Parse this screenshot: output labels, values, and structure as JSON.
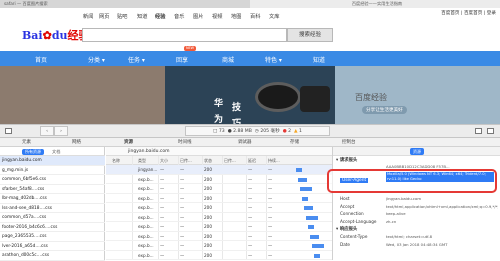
{
  "tabs": [
    "safari — 百度图片搜索",
    "百度经验——实用生活指南"
  ],
  "top_nav": [
    "新闻",
    "网页",
    "贴吧",
    "知道",
    "经验",
    "音乐",
    "图片",
    "视频",
    "地图",
    "百科",
    "文库"
  ],
  "top_links": "百度首页 | 百度首页 | 登录",
  "logo": {
    "bai": "Bai",
    "du": "du",
    "jingyan": "经验"
  },
  "search": {
    "value": "",
    "button": "搜索经验"
  },
  "main_nav": [
    "首页",
    "分类 ▾",
    "任务 ▾",
    "回享",
    "商城",
    "特色 ▾",
    "知道"
  ],
  "new_badge": "NEW",
  "banner": {
    "t1": "华",
    "t2": "技",
    "t3": "为",
    "t4": "巧",
    "brand": "百度经验",
    "slogan": "分享让生活更美好"
  },
  "toolbar": {
    "count": "73",
    "size": "2.88 MB",
    "time": "205 毫秒",
    "errors": "2",
    "warnings": "1"
  },
  "devtabs": [
    "元素",
    "网络",
    "资源",
    "时间线",
    "调试器",
    "存储",
    "控制台"
  ],
  "left": {
    "chip_all": "所有资源",
    "chip_doc": "文档",
    "rows": [
      "jingyan.baidu.com",
      "g_mg.min.js",
      "common_6bf5e6.css",
      "sfarber_54af8….css",
      "lbr-mag_d02db….css",
      "lss-and-see_d818….css",
      "common_d57a….css",
      "footer-2016_b4c6c6….css",
      "page_2365535….css",
      "lver-2016_a65d….css",
      "arathon_d00c5c….css"
    ]
  },
  "network": {
    "url": "jingyan.baidu.com",
    "headers": [
      "名称",
      "类型",
      "大小",
      "已传...",
      "状态",
      "已传...",
      "延迟",
      "持续..."
    ],
    "rows": [
      {
        "type": "jingyan...",
        "size": "—",
        "transferred": "—",
        "status": "200",
        "latency": "—",
        "duration": "—"
      },
      {
        "type": "exp.b...",
        "size": "—",
        "transferred": "—",
        "status": "200",
        "latency": "—",
        "duration": "—"
      },
      {
        "type": "exp.b...",
        "size": "—",
        "transferred": "—",
        "status": "200",
        "latency": "—",
        "duration": "—"
      },
      {
        "type": "exp.b...",
        "size": "—",
        "transferred": "—",
        "status": "200",
        "latency": "—",
        "duration": "—"
      },
      {
        "type": "exp.b...",
        "size": "—",
        "transferred": "—",
        "status": "200",
        "latency": "—",
        "duration": "—"
      },
      {
        "type": "exp.b...",
        "size": "—",
        "transferred": "—",
        "status": "200",
        "latency": "—",
        "duration": "—"
      },
      {
        "type": "exp.b...",
        "size": "—",
        "transferred": "—",
        "status": "200",
        "latency": "—",
        "duration": "—"
      },
      {
        "type": "exp.b...",
        "size": "—",
        "transferred": "—",
        "status": "200",
        "latency": "—",
        "duration": "—"
      },
      {
        "type": "exp.b...",
        "size": "—",
        "transferred": "—",
        "status": "200",
        "latency": "—",
        "duration": "—"
      },
      {
        "type": "exp.b...",
        "size": "—",
        "transferred": "—",
        "status": "200",
        "latency": "—",
        "duration": "—"
      }
    ]
  },
  "details": {
    "tab": "资源",
    "request_section": "▾ 请求报头",
    "user_agent_key": "User-Agent",
    "user_agent_value": "Mozilla/5.0 (Windows NT 6.3; Win64; x64; Trident/7.0; rv:11.0) like Gecko",
    "top_value": "AAA0BBB10D12C3ADD08 F57B...",
    "req_headers": [
      {
        "k": "Host",
        "v": "jingyan.baidu.com"
      },
      {
        "k": "Accept",
        "v": "text/html,application/xhtml+xml,application/xml;q=0.9,*/*;q=0.8"
      },
      {
        "k": "Connection",
        "v": "keep-alive"
      },
      {
        "k": "Accept-Language",
        "v": "zh-cn"
      }
    ],
    "response_section": "▾ 响应报头",
    "resp_headers": [
      {
        "k": "Content-Type",
        "v": "text/html; charset=utf-8"
      },
      {
        "k": "Date",
        "v": "Wed, 03 Jan 2018 04:48:34 GMT"
      }
    ]
  }
}
